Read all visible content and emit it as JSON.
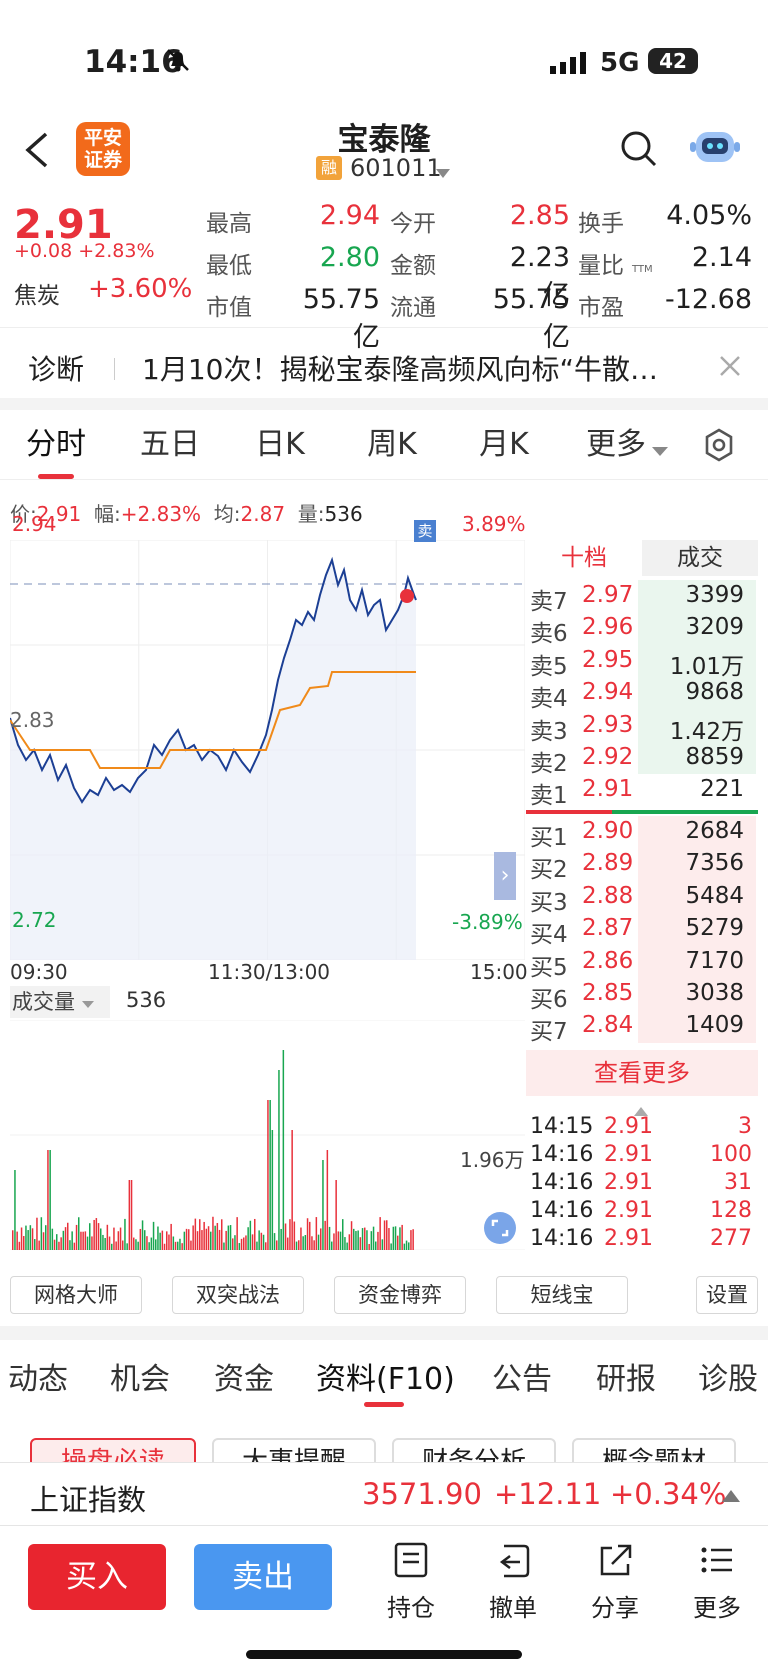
{
  "status": {
    "time": "14:16",
    "network": "5G",
    "battery": "42"
  },
  "header": {
    "logo_line1": "平安",
    "logo_line2": "证券",
    "title": "宝泰隆",
    "tag": "融",
    "code": "601011"
  },
  "quote": {
    "price": "2.91",
    "change": "+0.08 +2.83%",
    "sector_name": "焦炭",
    "sector_change": "+3.60%",
    "fields": [
      {
        "k": "最高",
        "v": "2.94",
        "c": "red"
      },
      {
        "k": "今开",
        "v": "2.85",
        "c": "red"
      },
      {
        "k": "换手",
        "v": "4.05%",
        "c": "black"
      },
      {
        "k": "最低",
        "v": "2.80",
        "c": "green"
      },
      {
        "k": "金额",
        "v": "2.23亿",
        "c": "black"
      },
      {
        "k": "量比",
        "v": "2.14",
        "c": "black"
      },
      {
        "k": "市值",
        "v": "55.75亿",
        "c": "black"
      },
      {
        "k": "流通",
        "v": "55.75亿",
        "c": "black"
      },
      {
        "k": "市盈",
        "v": "-12.68",
        "c": "black",
        "sup": "TTM"
      }
    ]
  },
  "diagnosis": {
    "label": "诊断",
    "text": "1月10次！揭秘宝泰隆高频风向标“牛散…"
  },
  "chart_tabs": [
    "分时",
    "五日",
    "日K",
    "周K",
    "月K",
    "更多"
  ],
  "info_line": {
    "p_label": "价:",
    "p": "2.91",
    "f_label": "幅:",
    "f": "+2.83%",
    "a_label": "均:",
    "a": "2.87",
    "v_label": "量:",
    "v": "536"
  },
  "chart": {
    "y_top": "2.94",
    "y_mid": "2.83",
    "y_bot": "2.72",
    "pct_top": "3.89%",
    "pct_bot": "-3.89%",
    "t_start": "09:30",
    "t_mid": "11:30/13:00",
    "t_end": "15:00",
    "sell_tag": "卖",
    "vol_label": "成交量",
    "vol_value": "536",
    "vol_max": "1.96万"
  },
  "orderbook": {
    "tab1": "十档",
    "tab2": "成交",
    "asks": [
      {
        "l": "卖7",
        "p": "2.97",
        "v": "3399"
      },
      {
        "l": "卖6",
        "p": "2.96",
        "v": "3209"
      },
      {
        "l": "卖5",
        "p": "2.95",
        "v": "1.01万"
      },
      {
        "l": "卖4",
        "p": "2.94",
        "v": "9868"
      },
      {
        "l": "卖3",
        "p": "2.93",
        "v": "1.42万"
      },
      {
        "l": "卖2",
        "p": "2.92",
        "v": "8859"
      },
      {
        "l": "卖1",
        "p": "2.91",
        "v": "221"
      }
    ],
    "bids": [
      {
        "l": "买1",
        "p": "2.90",
        "v": "2684"
      },
      {
        "l": "买2",
        "p": "2.89",
        "v": "7356"
      },
      {
        "l": "买3",
        "p": "2.88",
        "v": "5484"
      },
      {
        "l": "买4",
        "p": "2.87",
        "v": "5279"
      },
      {
        "l": "买5",
        "p": "2.86",
        "v": "7170"
      },
      {
        "l": "买6",
        "p": "2.85",
        "v": "3038"
      },
      {
        "l": "买7",
        "p": "2.84",
        "v": "1409"
      }
    ],
    "more": "查看更多"
  },
  "trades": [
    {
      "t": "14:15",
      "p": "2.91",
      "v": "3"
    },
    {
      "t": "14:16",
      "p": "2.91",
      "v": "100"
    },
    {
      "t": "14:16",
      "p": "2.91",
      "v": "31"
    },
    {
      "t": "14:16",
      "p": "2.91",
      "v": "128"
    },
    {
      "t": "14:16",
      "p": "2.91",
      "v": "277"
    }
  ],
  "tool_buttons": [
    "网格大师",
    "双突战法",
    "资金博弈",
    "短线宝",
    "设置"
  ],
  "f10_tabs": [
    "动态",
    "机会",
    "资金",
    "资料(F10)",
    "公告",
    "研报",
    "诊股"
  ],
  "peek_buttons": [
    "操盘必读",
    "大事提醒",
    "财务分析",
    "概念题材"
  ],
  "index": {
    "name": "上证指数",
    "value": "3571.90",
    "change": "+12.11",
    "pct": "+0.34%"
  },
  "bottom": {
    "buy": "买入",
    "sell": "卖出",
    "items": [
      "持仓",
      "撤单",
      "分享",
      "更多"
    ]
  },
  "colors": {
    "up": "#e8313b",
    "down": "#18a650",
    "price_line": "#1c3f94",
    "avg_line": "#f08a1a",
    "buy_btn": "#e8252f",
    "sell_btn": "#4a97f0"
  }
}
